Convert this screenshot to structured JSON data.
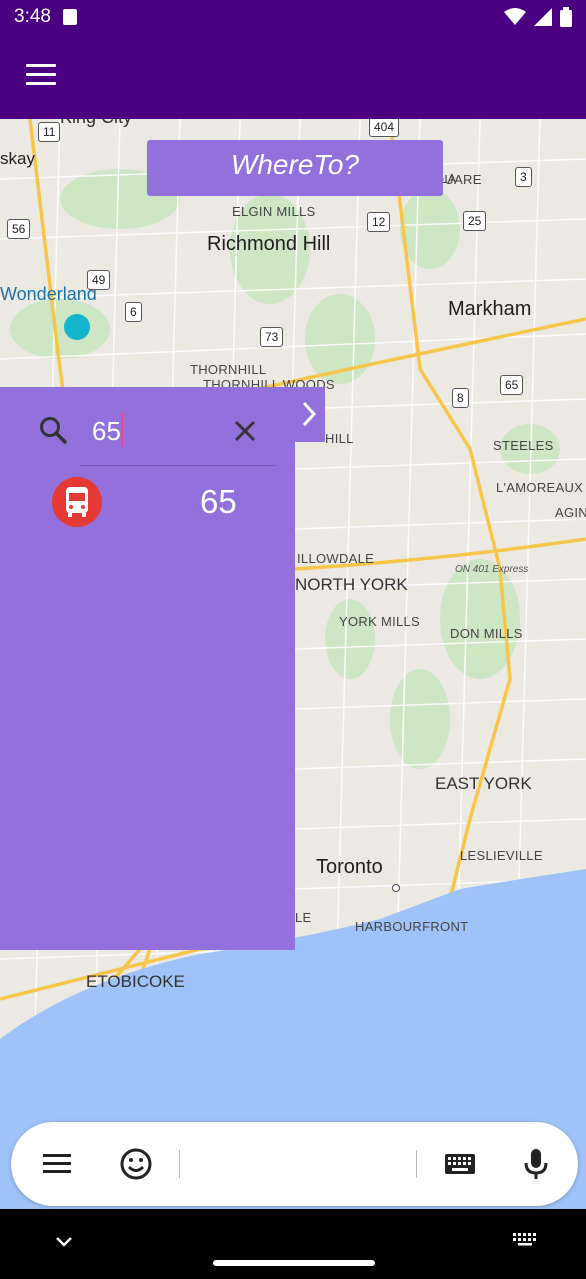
{
  "status_bar": {
    "time": "3:48"
  },
  "app_bar": {
    "menu_icon": "hamburger-menu-icon"
  },
  "header_button": {
    "label": "WhereTo?"
  },
  "map": {
    "labels": {
      "richmond_hill": "Richmond Hill",
      "markham": "Markham",
      "toronto": "Toronto",
      "north_york": "NORTH YORK",
      "east_york": "EAST YORK",
      "etobicoke": "ETOBICOKE",
      "elgin_mills": "ELGIN MILLS",
      "thornhill_woods": "THORNHILL WOODS",
      "thornhill": "THORNHILL",
      "hill": "HILL",
      "steeles": "STEELES",
      "lamoreaux": "L'AMOREAUX",
      "agin": "AGIN",
      "willowdale": "ILLOWDALE",
      "york_mills": "YORK MILLS",
      "don_mills": "DON MILLS",
      "leslieville": "LESLIEVILLE",
      "harbourfront": "HARBOURFRONT",
      "le": "LE",
      "king_city": "King City",
      "wonderland": "Wonderland",
      "skay": "skay",
      "on401": "ON 401 Express",
      "square": "SQUARE",
      "la": "LA"
    },
    "shields": [
      "11",
      "404",
      "3",
      "56",
      "12",
      "25",
      "49",
      "6",
      "73",
      "8",
      "65"
    ]
  },
  "search": {
    "value": "65",
    "search_icon": "search-icon",
    "clear_icon": "close-icon"
  },
  "results": [
    {
      "icon": "bus-icon",
      "label": "65"
    }
  ],
  "keyboard_bar": {
    "icons": [
      "menu-icon",
      "emoji-icon",
      "keyboard-icon",
      "microphone-icon"
    ]
  },
  "colors": {
    "primary": "#4b0082",
    "panel": "#9370db",
    "bus": "#e53935"
  }
}
